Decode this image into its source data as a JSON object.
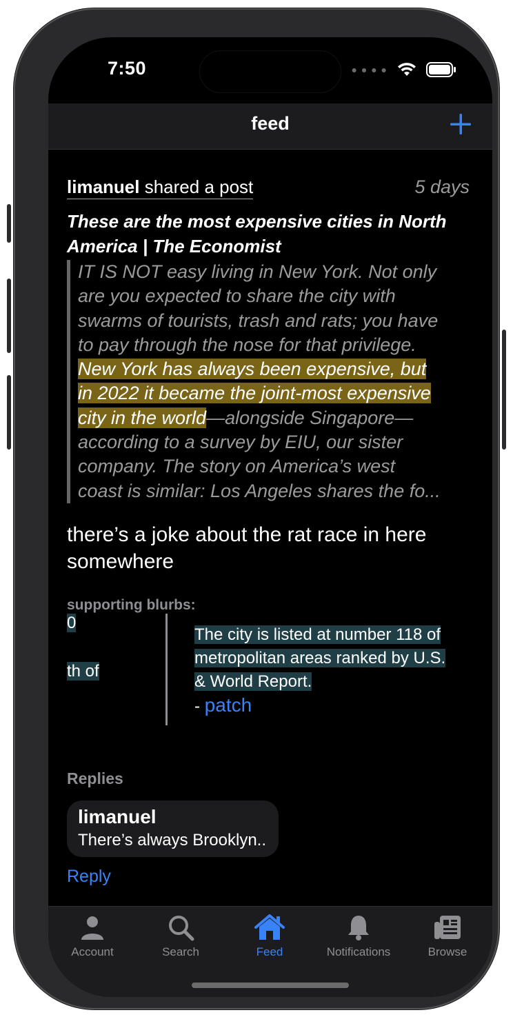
{
  "status": {
    "time": "7:50"
  },
  "nav": {
    "title": "feed",
    "add_icon": "plus-icon"
  },
  "post": {
    "author": "limanuel",
    "action": "shared a post",
    "age": "5 days",
    "article_title": "These are the most expensive cities in North America | The Economist",
    "excerpt_lines_before": [
      "IT IS NOT easy living in New York. Not only",
      "are you expected to share the city with",
      "swarms of tourists, trash and rats; you have",
      "to pay through the nose for that privilege."
    ],
    "highlight_lines": [
      "New York has always been expensive, but",
      "in 2022 it became the joint-most expensive",
      "city in the world"
    ],
    "excerpt_lines_after": [
      "—alongside Singapore—",
      "according to a survey by EIU, our sister",
      "company. The story on America’s west",
      "coast is similar: Los Angeles shares the fo..."
    ],
    "comment": "there’s a joke about the rat race in here somewhere",
    "supporting_label": "supporting blurbs:",
    "blurb_index_1": "0",
    "blurb_index_2": "th of",
    "blurb_lines": [
      "The city is listed at number 118 of",
      "metropolitan areas ranked by U.S.",
      "& World Report."
    ],
    "blurb_dash": "- ",
    "blurb_source": "patch"
  },
  "replies": {
    "label": "Replies",
    "items": [
      {
        "user": "limanuel",
        "text": "There’s always Brooklyn.."
      }
    ],
    "reply_link": "Reply"
  },
  "tabs": [
    {
      "label": "Account",
      "icon": "person-icon",
      "active": false
    },
    {
      "label": "Search",
      "icon": "search-icon",
      "active": false
    },
    {
      "label": "Feed",
      "icon": "house-icon",
      "active": true
    },
    {
      "label": "Notifications",
      "icon": "bell-icon",
      "active": false
    },
    {
      "label": "Browse",
      "icon": "newspaper-icon",
      "active": false
    }
  ],
  "colors": {
    "accent": "#3a82f7",
    "highlight": "#7a6418",
    "blurb_bg": "#203e45"
  }
}
